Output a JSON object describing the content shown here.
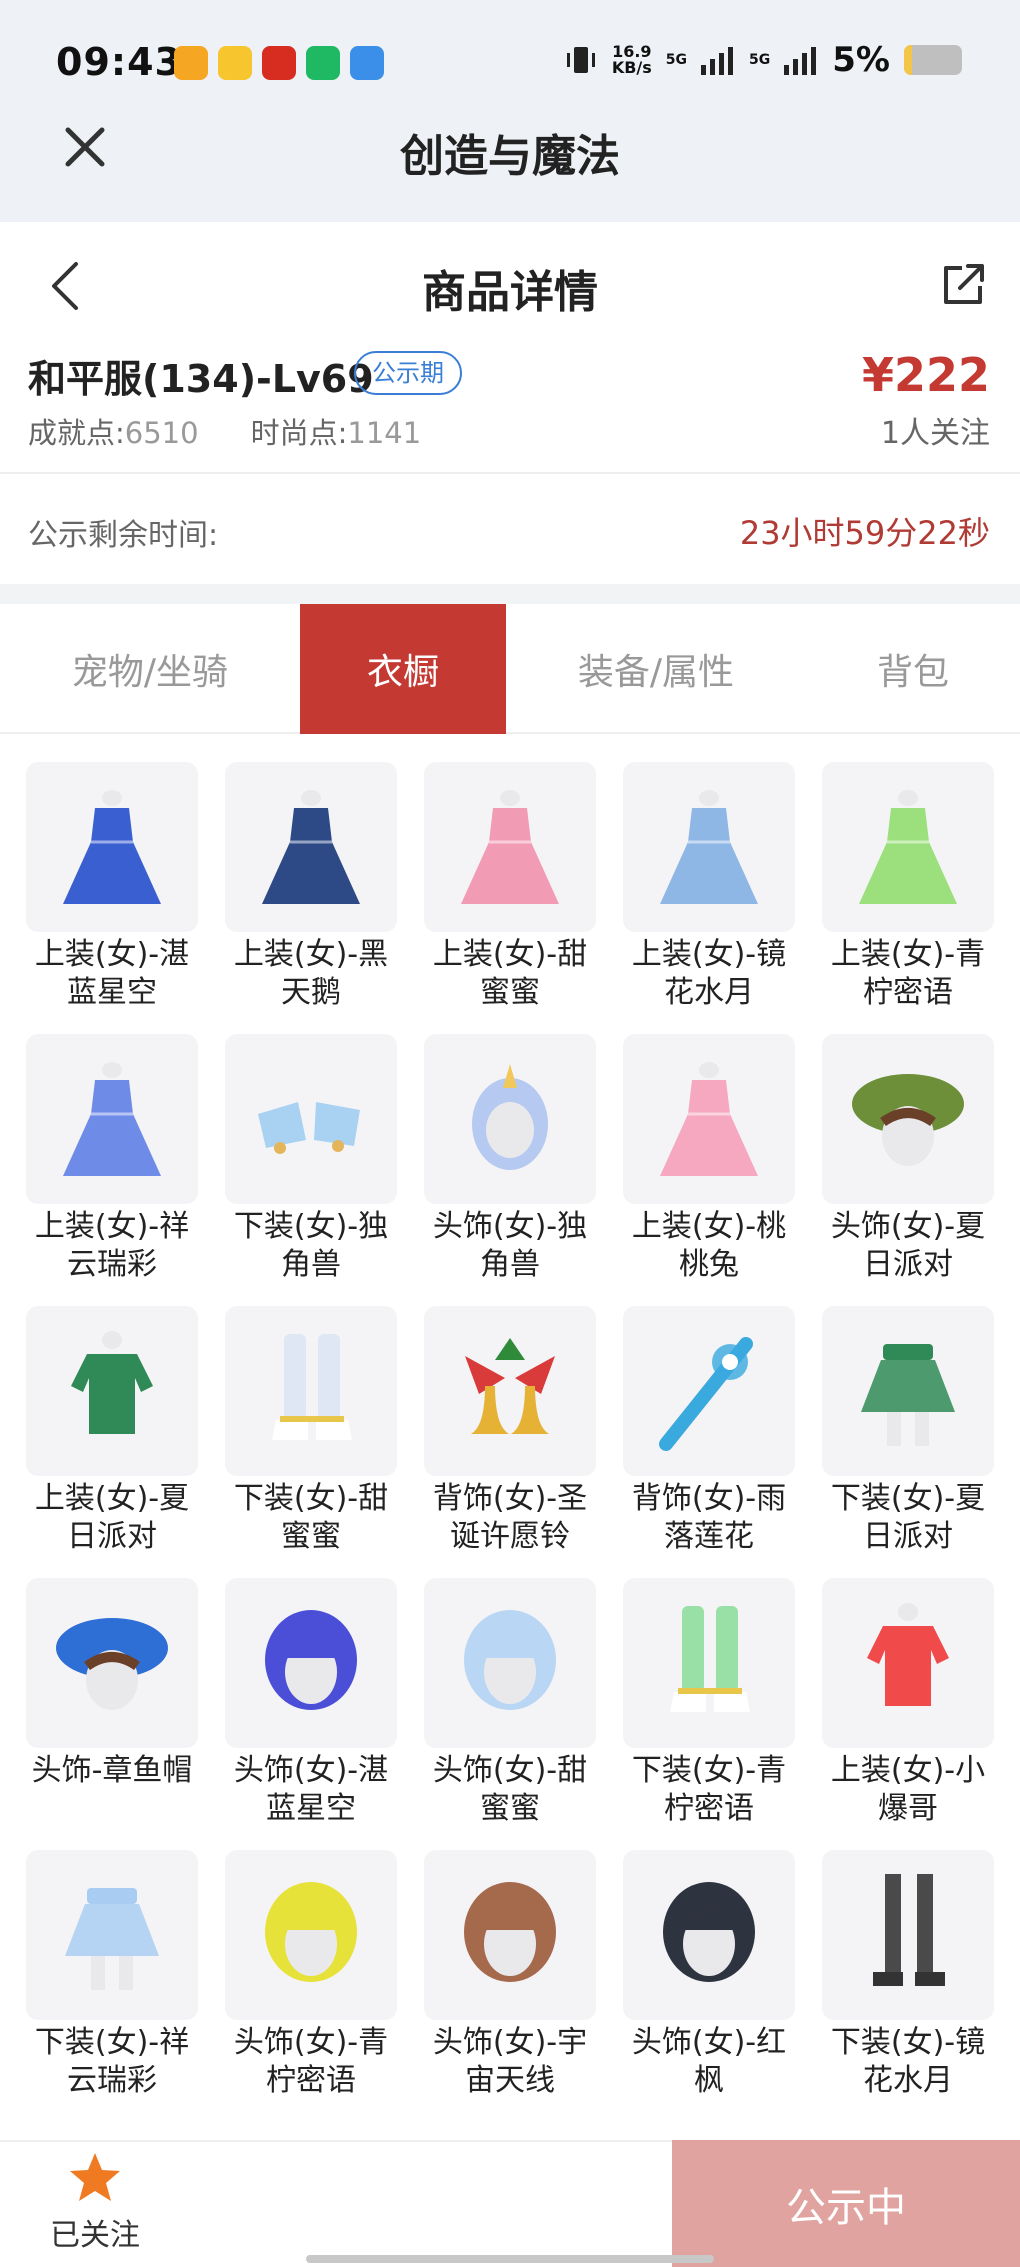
{
  "status_bar": {
    "time": "09:43",
    "net_speed": "16.9",
    "net_unit": "KB/s",
    "signal1": "5G",
    "signal2": "5G",
    "battery": "5%",
    "app_colors": [
      "#f5a623",
      "#f7c52e",
      "#d62d20",
      "#1fb863",
      "#3b8fe8"
    ]
  },
  "app_bar": {
    "title": "创造与魔法"
  },
  "sub_header": {
    "title": "商品详情"
  },
  "product": {
    "name": "和平服(134)-Lv69",
    "badge": "公示期",
    "price": "¥222",
    "achievement_label": "成就点:",
    "achievement_value": "6510",
    "fashion_label": "时尚点:",
    "fashion_value": "1141",
    "followers": "1人关注"
  },
  "timer": {
    "label": "公示剩余时间:",
    "value": "23小时59分22秒"
  },
  "tabs": [
    {
      "label": "宠物/坐骑",
      "active": false
    },
    {
      "label": "衣橱",
      "active": true
    },
    {
      "label": "装备/属性",
      "active": false
    },
    {
      "label": "背包",
      "active": false
    }
  ],
  "items": [
    {
      "name": "上装(女)-湛蓝星空",
      "icon": "dress",
      "color": "#3a5fd0"
    },
    {
      "name": "上装(女)-黑天鹅",
      "icon": "dress",
      "color": "#2d4a86"
    },
    {
      "name": "上装(女)-甜蜜蜜",
      "icon": "dress",
      "color": "#f29bb5"
    },
    {
      "name": "上装(女)-镜花水月",
      "icon": "dress",
      "color": "#8fb7e6"
    },
    {
      "name": "上装(女)-青柠密语",
      "icon": "dress",
      "color": "#9be07c"
    },
    {
      "name": "上装(女)-祥云瑞彩",
      "icon": "dress",
      "color": "#6f8be8"
    },
    {
      "name": "下装(女)-独角兽",
      "icon": "shoes",
      "color": "#a9d2f2"
    },
    {
      "name": "头饰(女)-独角兽",
      "icon": "head",
      "color": "#b6c9f0"
    },
    {
      "name": "上装(女)-桃桃兔",
      "icon": "dress",
      "color": "#f5a8c0"
    },
    {
      "name": "头饰(女)-夏日派对",
      "icon": "hat",
      "color": "#6d8f3a"
    },
    {
      "name": "上装(女)-夏日派对",
      "icon": "top",
      "color": "#2f8a57"
    },
    {
      "name": "下装(女)-甜蜜蜜",
      "icon": "boots",
      "color": "#dfe7f5"
    },
    {
      "name": "背饰(女)-圣诞许愿铃",
      "icon": "bell",
      "color": "#d93a3a"
    },
    {
      "name": "背饰(女)-雨落莲花",
      "icon": "staff",
      "color": "#39a9de"
    },
    {
      "name": "下装(女)-夏日派对",
      "icon": "skirt",
      "color": "#2f8a57"
    },
    {
      "name": "头饰-章鱼帽",
      "icon": "hat",
      "color": "#2e6fd6"
    },
    {
      "name": "头饰(女)-湛蓝星空",
      "icon": "hair",
      "color": "#4b4fd8"
    },
    {
      "name": "头饰(女)-甜蜜蜜",
      "icon": "hair",
      "color": "#b9d6f4"
    },
    {
      "name": "下装(女)-青柠密语",
      "icon": "boots",
      "color": "#98e0a6"
    },
    {
      "name": "上装(女)-小爆哥",
      "icon": "top",
      "color": "#f04a4a"
    },
    {
      "name": "下装(女)-祥云瑞彩",
      "icon": "skirt",
      "color": "#a9cdf2"
    },
    {
      "name": "头饰(女)-青柠密语",
      "icon": "hair",
      "color": "#e6e23a"
    },
    {
      "name": "头饰(女)-宇宙天线",
      "icon": "hair",
      "color": "#a5694c"
    },
    {
      "name": "头饰(女)-红枫",
      "icon": "hair",
      "color": "#2e3340"
    },
    {
      "name": "下装(女)-镜花水月",
      "icon": "legs",
      "color": "#4a4a4a"
    }
  ],
  "bottom": {
    "follow_label": "已关注",
    "action_label": "公示中"
  },
  "colors": {
    "accent": "#c43a33",
    "badge": "#3a7fd5",
    "cta": "#e0a3a0",
    "star": "#f07a22"
  }
}
